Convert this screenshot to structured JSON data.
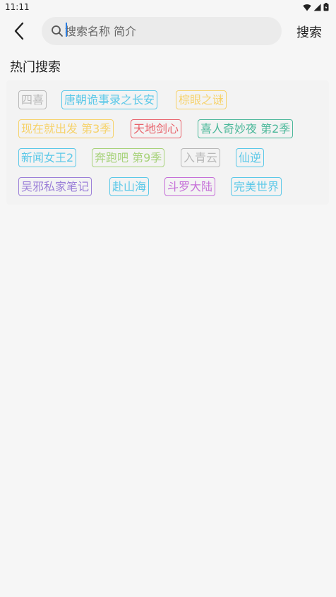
{
  "status_bar": {
    "time": "11:11"
  },
  "header": {
    "search_placeholder": "搜索名称 简介",
    "search_value": "",
    "search_button_label": "搜索"
  },
  "hot_search": {
    "title": "热门搜索",
    "tags": [
      {
        "label": "四喜",
        "color": "#b8b8b8"
      },
      {
        "label": "唐朝诡事录之长安",
        "color": "#5bc8e8"
      },
      {
        "label": "棕眼之谜",
        "color": "#f6d26a"
      },
      {
        "label": "现在就出发 第3季",
        "color": "#f6d26a"
      },
      {
        "label": "天地剑心",
        "color": "#e8636c"
      },
      {
        "label": "喜人奇妙夜 第2季",
        "color": "#4cb89a"
      },
      {
        "label": "新闻女王2",
        "color": "#5bc8e8"
      },
      {
        "label": "奔跑吧 第9季",
        "color": "#a7d27a"
      },
      {
        "label": "入青云",
        "color": "#b8b8b8"
      },
      {
        "label": "仙逆",
        "color": "#5bc8e8"
      },
      {
        "label": "吴邪私家笔记",
        "color": "#9b7fd8"
      },
      {
        "label": "赴山海",
        "color": "#5bc8e8"
      },
      {
        "label": "斗罗大陆",
        "color": "#c56fd8"
      },
      {
        "label": "完美世界",
        "color": "#5bc8e8"
      }
    ]
  }
}
